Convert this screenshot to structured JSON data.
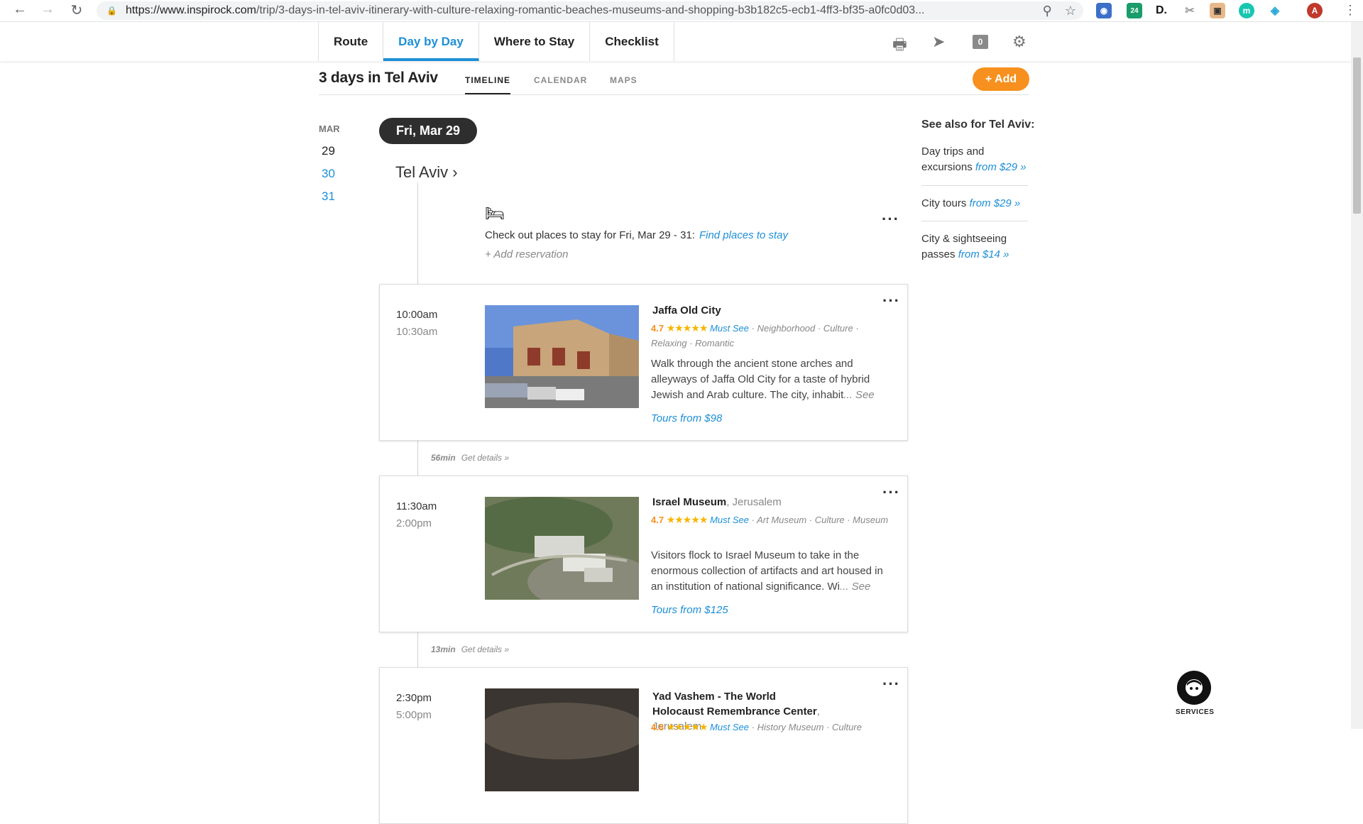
{
  "browser": {
    "url_host": "https://www.inspirock.com",
    "url_path": "/trip/3-days-in-tel-aviv-itinerary-with-culture-relaxing-romantic-beaches-museums-and-shopping-b3b182c5-ecb1-4ff3-bf35-a0fc0d03...",
    "ext_badge": "24",
    "profile_initial": "A"
  },
  "nav": {
    "tabs": [
      "Route",
      "Day by Day",
      "Where to Stay",
      "Checklist"
    ],
    "active_tab": "Day by Day",
    "comment_count": "0"
  },
  "header": {
    "trip_title": "3 days in Tel Aviv",
    "subtabs": [
      "TIMELINE",
      "CALENDAR",
      "MAPS"
    ],
    "add_label": "+ Add"
  },
  "calendar": {
    "month": "MAR",
    "days": [
      "29",
      "30",
      "31"
    ]
  },
  "day": {
    "pill": "Fri, Mar 29",
    "city": "Tel Aviv ›"
  },
  "stay": {
    "text": "Check out places to stay for Fri, Mar 29 - 31:",
    "link": "Find places to stay",
    "add_reservation": "+ Add reservation"
  },
  "places": [
    {
      "start": "10:00am",
      "end": "10:30am",
      "name": "Jaffa Old City",
      "location": "",
      "rating": "4.7",
      "stars": "★★★★★",
      "must_see": "Must See",
      "tags": "· Neighborhood · Culture · Relaxing · Romantic",
      "desc": "Walk through the ancient stone arches and alleyways of Jaffa Old City for a taste of hybrid Jewish and Arab culture. The city, inhabit",
      "see_more": "... See more",
      "tours": "Tours from $98"
    },
    {
      "start": "11:30am",
      "end": "2:00pm",
      "name": "Israel Museum",
      "location": ", Jerusalem",
      "rating": "4.7",
      "stars": "★★★★★",
      "must_see": "Must See",
      "tags": "· Art Museum · Culture · Museum",
      "desc": "Visitors flock to Israel Museum to take in the enormous collection of artifacts and art housed in an institution of national significance. Wi",
      "see_more": "... See more",
      "tours": "Tours from $125"
    },
    {
      "start": "2:30pm",
      "end": "5:00pm",
      "name": "Yad Vashem - The World Holocaust Remembrance Center",
      "location": ", Jerusalem",
      "rating": "4.8",
      "stars": "★★★★★",
      "must_see": "Must See",
      "tags": "· History Museum · Culture",
      "desc": "",
      "see_more": "",
      "tours": ""
    }
  ],
  "transfers": [
    {
      "duration": "56min",
      "link": "Get details »"
    },
    {
      "duration": "13min",
      "link": "Get details »"
    }
  ],
  "sidebar": {
    "title": "See also for Tel Aviv:",
    "items": [
      {
        "label": "Day trips and excursions",
        "price": "from $29 »"
      },
      {
        "label": "City tours",
        "price": "from $29 »"
      },
      {
        "label": "City & sightseeing passes",
        "price": "from $14 »"
      }
    ]
  },
  "services_label": "SERVICES"
}
